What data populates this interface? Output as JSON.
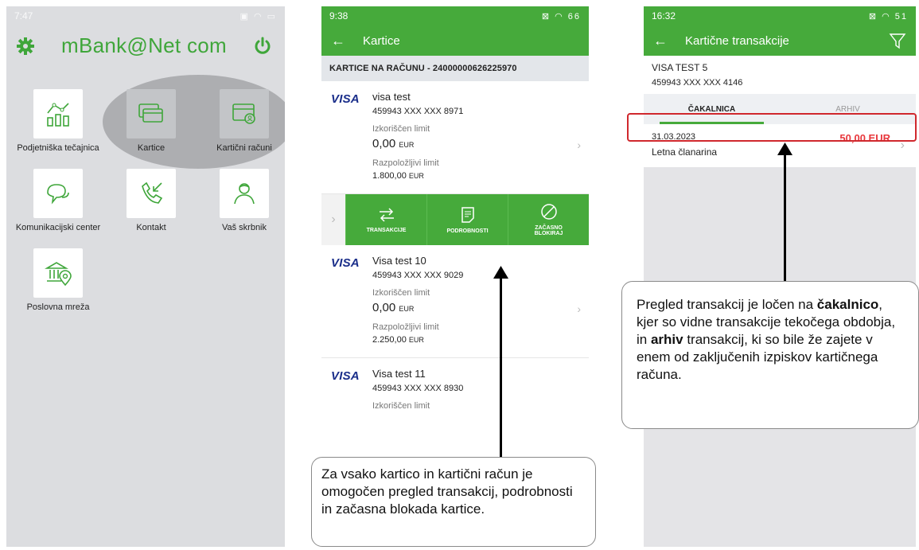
{
  "phone1": {
    "time": "7:47",
    "title": "mBank@Net com",
    "items": [
      {
        "label": "Podjetniška tečajnica",
        "icon": "chart-icon"
      },
      {
        "label": "Kartice",
        "icon": "cards-icon"
      },
      {
        "label": "Kartični računi",
        "icon": "card-account-icon"
      },
      {
        "label": "Komunikacijski center",
        "icon": "chat-icon"
      },
      {
        "label": "Kontakt",
        "icon": "phone-icon"
      },
      {
        "label": "Vaš skrbnik",
        "icon": "person-icon"
      },
      {
        "label": "Poslovna mreža",
        "icon": "bank-location-icon"
      }
    ]
  },
  "phone2": {
    "time": "9:38",
    "battery": "66",
    "title": "Kartice",
    "section": "KARTICE NA RAČUNU - 24000000626225970",
    "brand": "VISA",
    "used_limit_label": "Izkoriščen limit",
    "available_limit_label": "Razpoložljivi limit",
    "currency": "EUR",
    "cards": [
      {
        "name": "visa test",
        "number": "459943 XXX XXX 8971",
        "used": "0,00",
        "available": "1.800,00"
      },
      {
        "name": "Visa test 10",
        "number": "459943 XXX XXX 9029",
        "used": "0,00",
        "available": "2.250,00"
      },
      {
        "name": "Visa test 11",
        "number": "459943 XXX XXX 8930",
        "used": "",
        "available": ""
      }
    ],
    "actions": {
      "transactions": "TRANSAKCIJE",
      "details": "PODROBNOSTI",
      "block_line1": "ZAČASNO",
      "block_line2": "BLOKIRAJ"
    }
  },
  "phone3": {
    "time": "16:32",
    "battery": "51",
    "title": "Kartične transakcije",
    "card_name": "VISA TEST 5",
    "card_number": "459943 XXX XXX 4146",
    "tab_waiting": "ČAKALNICA",
    "tab_archive": "ARHIV",
    "transaction": {
      "date": "31.03.2023",
      "description": "Letna članarina",
      "amount": "50,00 EUR"
    }
  },
  "callout1": {
    "text": "Za vsako kartico in kartični račun je omogočen pregled transakcij, podrobnosti in začasna blokada kartice."
  },
  "callout2": {
    "p1": "Pregled transakcij je ločen na ",
    "b1": "čakalnico",
    "p2": ", kjer so vidne transakcije tekočega obdobja, in ",
    "b2": "arhiv",
    "p3": " transakcij, ki so bile že zajete v enem od zaključenih izpiskov kartičnega računa."
  },
  "colors": {
    "green": "#46aa3b",
    "red": "#e8383d",
    "visa_blue": "#1a2e8a"
  }
}
